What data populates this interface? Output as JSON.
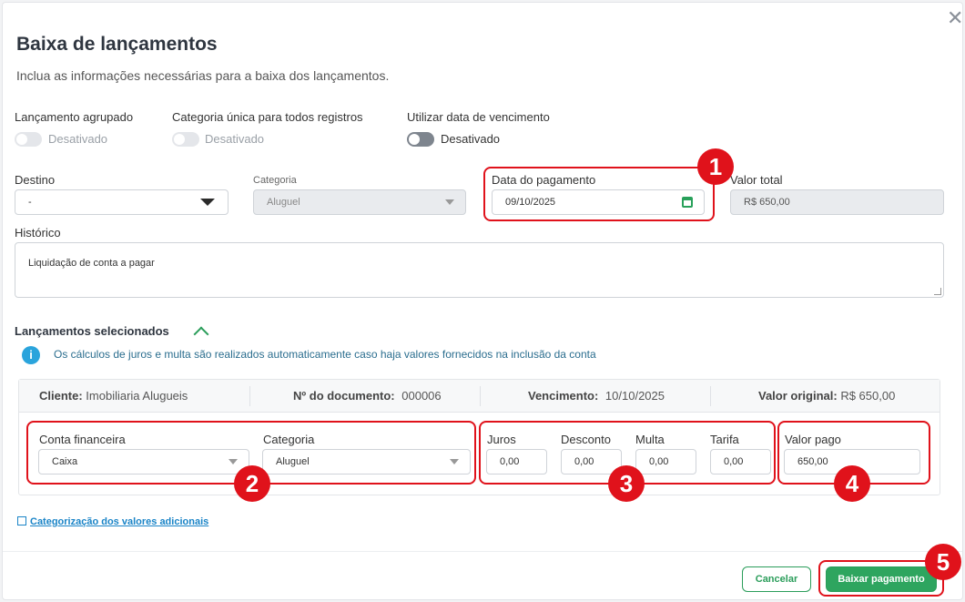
{
  "modal": {
    "title": "Baixa de lançamentos",
    "subtitle": "Inclua as informações necessárias para a baixa dos lançamentos.",
    "close_icon": "close-icon"
  },
  "toggles": [
    {
      "label": "Lançamento agrupado",
      "state": "Desativado"
    },
    {
      "label": "Categoria única para todos registros",
      "state": "Desativado"
    },
    {
      "label": "Utilizar data de vencimento",
      "state": "Desativado"
    }
  ],
  "fields": {
    "destino": {
      "label": "Destino",
      "value": "-"
    },
    "categoria": {
      "label": "Categoria",
      "value": "Aluguel"
    },
    "data_pagamento": {
      "label": "Data do pagamento",
      "value": "09/10/2025"
    },
    "valor_total": {
      "label": "Valor total",
      "value": "R$ 650,00"
    },
    "historico": {
      "label": "Histórico",
      "value": "Liquidação de conta a pagar"
    }
  },
  "section": {
    "title": "Lançamentos selecionados",
    "info": "Os cálculos de juros e multa são realizados automaticamente caso haja valores fornecidos na inclusão da conta"
  },
  "table": {
    "cliente_label": "Cliente:",
    "cliente_value": "Imobiliaria Alugueis",
    "documento_label": "Nº do documento:",
    "documento_value": "000006",
    "vencimento_label": "Vencimento:",
    "vencimento_value": "10/10/2025",
    "valor_label": "Valor original:",
    "valor_value": "R$ 650,00"
  },
  "row": {
    "conta_label": "Conta financeira",
    "conta_value": "Caixa",
    "categoria_label": "Categoria",
    "categoria_value": "Aluguel",
    "juros_label": "Juros",
    "juros_value": "0,00",
    "desconto_label": "Desconto",
    "desconto_value": "0,00",
    "multa_label": "Multa",
    "multa_value": "0,00",
    "tarifa_label": "Tarifa",
    "tarifa_value": "0,00",
    "valor_pago_label": "Valor pago",
    "valor_pago_value": "650,00"
  },
  "link": "Categorização dos valores adicionais",
  "buttons": {
    "cancel": "Cancelar",
    "primary": "Baixar pagamento"
  },
  "badges": [
    "1",
    "2",
    "3",
    "4",
    "5"
  ],
  "colors": {
    "accent": "#2ea55f",
    "annotation": "#e0121b",
    "info": "#2aa4dc"
  }
}
